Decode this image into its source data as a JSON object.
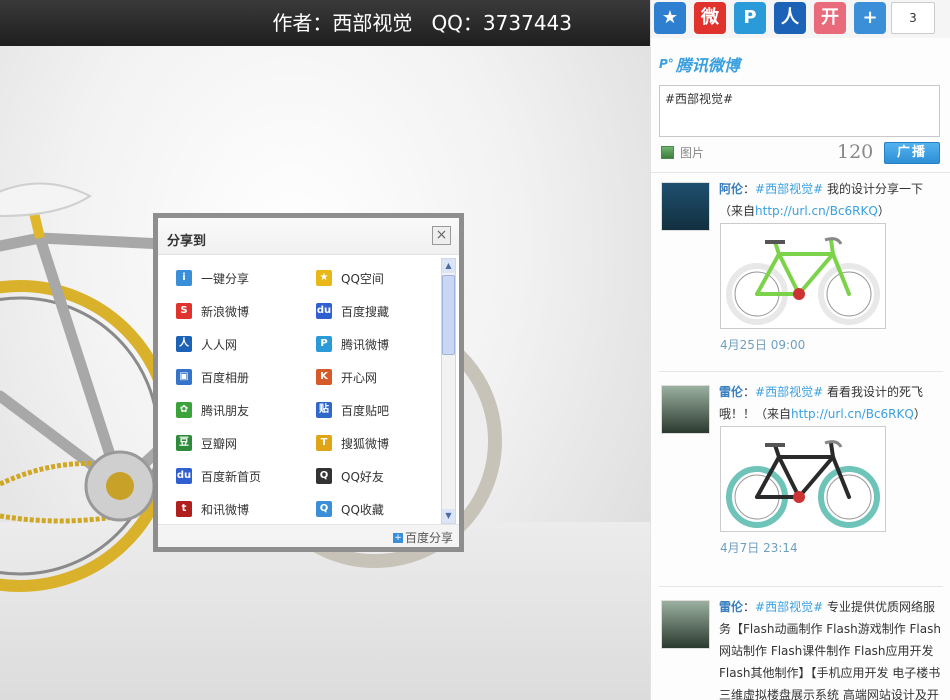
{
  "header": {
    "author_text": "作者：西部视觉",
    "qq_text": "QQ：3737443"
  },
  "share_dialog": {
    "title": "分享到",
    "close": "×",
    "items": [
      {
        "label": "一键分享",
        "icon": "share-all-icon",
        "color": "#3a8fd8",
        "glyph": "i"
      },
      {
        "label": "QQ空间",
        "icon": "qzone-icon",
        "color": "#e8b81a",
        "glyph": "★"
      },
      {
        "label": "新浪微博",
        "icon": "sina-weibo-icon",
        "color": "#e0332e",
        "glyph": "S"
      },
      {
        "label": "百度搜藏",
        "icon": "baidu-paw-icon",
        "color": "#2f5fd0",
        "glyph": "du"
      },
      {
        "label": "人人网",
        "icon": "renren-icon",
        "color": "#1c63b8",
        "glyph": "人"
      },
      {
        "label": "腾讯微博",
        "icon": "tencent-weibo-icon",
        "color": "#2b9ad8",
        "glyph": "P"
      },
      {
        "label": "百度相册",
        "icon": "baidu-album-icon",
        "color": "#3574c8",
        "glyph": "▣"
      },
      {
        "label": "开心网",
        "icon": "kaixin-icon",
        "color": "#d65a2a",
        "glyph": "K"
      },
      {
        "label": "腾讯朋友",
        "icon": "pengyou-icon",
        "color": "#3aa33a",
        "glyph": "✿"
      },
      {
        "label": "百度贴吧",
        "icon": "tieba-icon",
        "color": "#2f68c8",
        "glyph": "贴"
      },
      {
        "label": "豆瓣网",
        "icon": "douban-icon",
        "color": "#2e8b3a",
        "glyph": "豆"
      },
      {
        "label": "搜狐微博",
        "icon": "sohu-weibo-icon",
        "color": "#e0a516",
        "glyph": "T"
      },
      {
        "label": "百度新首页",
        "icon": "baidu-home-icon",
        "color": "#2f5fd0",
        "glyph": "du"
      },
      {
        "label": "QQ好友",
        "icon": "qq-penguin-icon",
        "color": "#333333",
        "glyph": "Q"
      },
      {
        "label": "和讯微博",
        "icon": "hexun-icon",
        "color": "#b01e1e",
        "glyph": "t"
      },
      {
        "label": "QQ收藏",
        "icon": "qq-bookmark-icon",
        "color": "#3a8fd8",
        "glyph": "Q"
      }
    ],
    "footer": "百度分享"
  },
  "social_bar": {
    "icons": [
      {
        "name": "qzone-share-icon",
        "color": "#2f7fd0",
        "glyph": "★"
      },
      {
        "name": "sina-weibo-share-icon",
        "color": "#e0332e",
        "glyph": "微"
      },
      {
        "name": "tencent-weibo-share-icon",
        "color": "#2b9ad8",
        "glyph": "P"
      },
      {
        "name": "renren-share-icon",
        "color": "#1c63b8",
        "glyph": "人"
      },
      {
        "name": "kaixin-share-icon",
        "color": "#e96a7a",
        "glyph": "开"
      },
      {
        "name": "more-share-icon",
        "color": "#3b8fd8",
        "glyph": "+"
      }
    ],
    "count": "3"
  },
  "weibo": {
    "logo": "腾讯微博",
    "compose_text": "#西部视觉#",
    "pic_label": "图片",
    "counter": "120",
    "broadcast_label": "广播"
  },
  "posts": [
    {
      "name": "阿伦",
      "sep": "：",
      "tag": "#西部视觉#",
      "text": " 我的设计分享一下（来自",
      "link": "http://url.cn/Bc6RKQ",
      "tail": "）",
      "time": "4月25日 09:00",
      "bike_color": "#7cd34a",
      "wheel_color": "#e8e8e8"
    },
    {
      "name": "雷伦",
      "sep": "：",
      "tag": "#西部视觉#",
      "text": " 看看我设计的死飞哦！！（来自",
      "link": "http://url.cn/Bc6RKQ",
      "tail": "）",
      "time": "4月7日 23:14",
      "bike_color": "#2a2a2a",
      "wheel_color": "#6ec4b8"
    },
    {
      "name": "雷伦",
      "sep": "：",
      "tag": "#西部视觉#",
      "text": " 专业提供优质网络服务【Flash动画制作 Flash游戏制作 Flash网站制作 Flash课件制作 Flash应用开发 Flash其他制作】【手机应用开发 电子楼书 三维虚拟楼盘展示系统 高端网站设计及开发"
    }
  ]
}
